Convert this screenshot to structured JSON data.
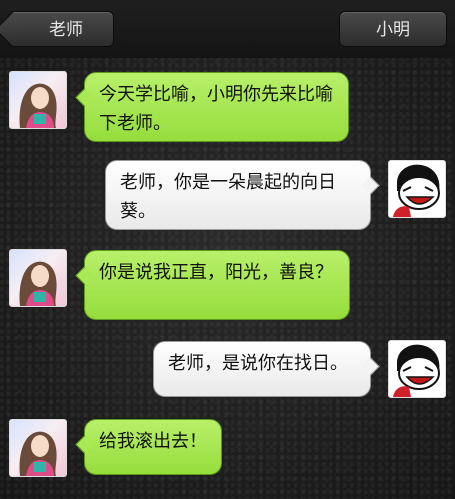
{
  "header": {
    "back_label": "老师",
    "contact_label": "小明"
  },
  "messages": [
    {
      "from": "teacher",
      "text": "今天学比喻，小明你先来比喻下老师。"
    },
    {
      "from": "xiaoming",
      "text": "老师，你是一朵晨起的向日葵。"
    },
    {
      "from": "teacher",
      "text": "你是说我正直，阳光，善良？"
    },
    {
      "from": "xiaoming",
      "text": "老师，是说你在找日。"
    },
    {
      "from": "teacher",
      "text": "给我滚出去！"
    }
  ],
  "colors": {
    "incoming_bubble": "#a8e954",
    "outgoing_bubble": "#ffffff",
    "background": "#1d1d1d"
  }
}
